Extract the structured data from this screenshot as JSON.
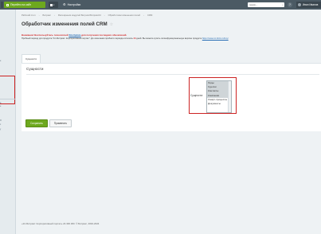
{
  "topbar": {
    "home_button": "Перейти на сайт",
    "settings": "Настройки",
    "search_placeholder": "поиск...",
    "help": "?",
    "user_name": "Иван Иванов"
  },
  "left_panel": {
    "items": [
      "e",
      "а",
      "е",
      "О",
      "с",
      "у"
    ]
  },
  "breadcrumb": [
    "Рабочий стол",
    "Битрикс",
    "Расширения модулей Битрикс/Битрикс24",
    "Обработчики изменения полей",
    "CRM"
  ],
  "page_title": "Обработчик изменения полей CRM",
  "notice": {
    "line1_prefix": "Внимание! Воспользуйтесь технологией ",
    "line1_link": "SiteUpdate",
    "line1_suffix": " для получения последних обновлений.",
    "line2_prefix": "Пробный период для продукта \"1С-Битрикс: Корпоративный портал\". До окончания пробного периода осталось ",
    "line2_days": "24",
    "line2_middle": " дней. Вы можете купить полнофункциональную версию продукта ",
    "line2_link": "https://www.1c-bitrix.ru/buy/"
  },
  "tabs": [
    "Сущности"
  ],
  "section_heading": "Сущности",
  "field_label": "Сущности:",
  "entities": [
    {
      "label": "Лиды",
      "selected": true
    },
    {
      "label": "Сделки",
      "selected": true
    },
    {
      "label": "Контакты",
      "selected": true
    },
    {
      "label": "Компании",
      "selected": true
    },
    {
      "label": "Смарт-процессы",
      "selected": false
    },
    {
      "label": "Документы",
      "selected": false
    }
  ],
  "buttons": {
    "save": "Сохранить",
    "apply": "Применить"
  },
  "footer": "«1С-Битрикс: Корпоративный портал» 24.300.300. © Битрикс, 2002-2024",
  "colors": {
    "topbar": "#4b5a64",
    "accent_green": "#6da81e",
    "highlight_red": "#cc2222",
    "link_blue": "#2a6fb5"
  }
}
